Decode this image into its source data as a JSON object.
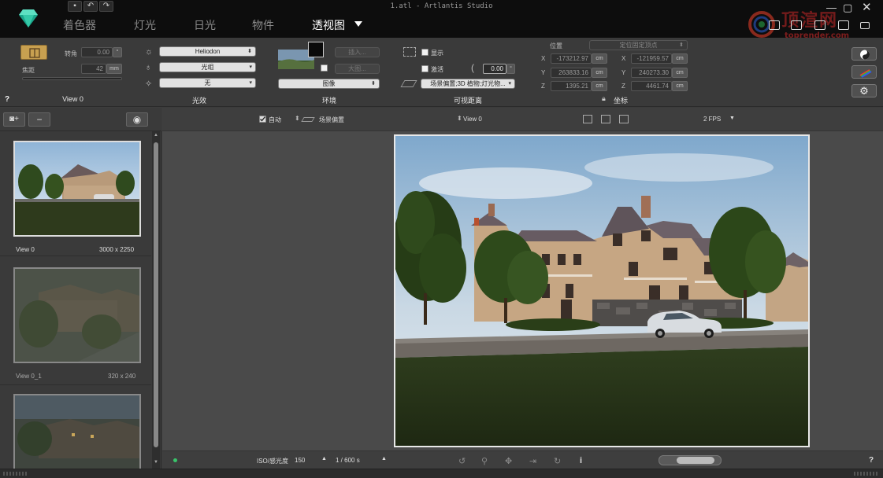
{
  "app": {
    "window_title": "1.atl - Artlantis Studio",
    "tabs": [
      "着色器",
      "灯光",
      "日光",
      "物件",
      "透视图"
    ],
    "active_tab": "透视图"
  },
  "watermark": {
    "text": "顶渲网",
    "url": "toprender.com"
  },
  "panel": {
    "view": {
      "roll_label": "转角",
      "roll_value": "0.00",
      "roll_unit": "°",
      "focal_label": "焦距",
      "focal_value": "42",
      "focal_unit": "mm",
      "section": "View 0"
    },
    "lighting": {
      "heliodon": "Heliodon",
      "light": "光组",
      "none": "无",
      "section": "光效"
    },
    "environment": {
      "insert_label": "插入...",
      "size_label": "大图...",
      "image_select": "图像",
      "section": "环境"
    },
    "clipping": {
      "show_label": "显示",
      "activate_label": "激活",
      "angle_value": "0.00",
      "angle_unit": "°",
      "depth_select": "场景偏置;3D 植物;灯光物...",
      "section": "可视距离"
    },
    "coords": {
      "position_label": "位置",
      "target_select": "定位固定顶点",
      "left": {
        "x": "-173212.97",
        "y": "263833.16",
        "z": "1395.21"
      },
      "right": {
        "x": "-121959.57",
        "y": "240273.30",
        "z": "4461.74"
      },
      "unit": "cm",
      "section": "坐标"
    },
    "help": "?"
  },
  "sidebar": {
    "thumbnails": [
      {
        "name": "View 0",
        "size": "3000 x 2250"
      },
      {
        "name": "View 0_1",
        "size": "320 x 240"
      },
      {
        "name": "",
        "size": ""
      }
    ]
  },
  "viewbar": {
    "auto_label": "自动",
    "preset_label": "场景偏置",
    "view_select": "View 0",
    "fps": "2 FPS"
  },
  "bottombar": {
    "iso_label": "ISO/感光度",
    "iso_value": "150",
    "shutter": "1 / 600 s",
    "help": "?"
  }
}
